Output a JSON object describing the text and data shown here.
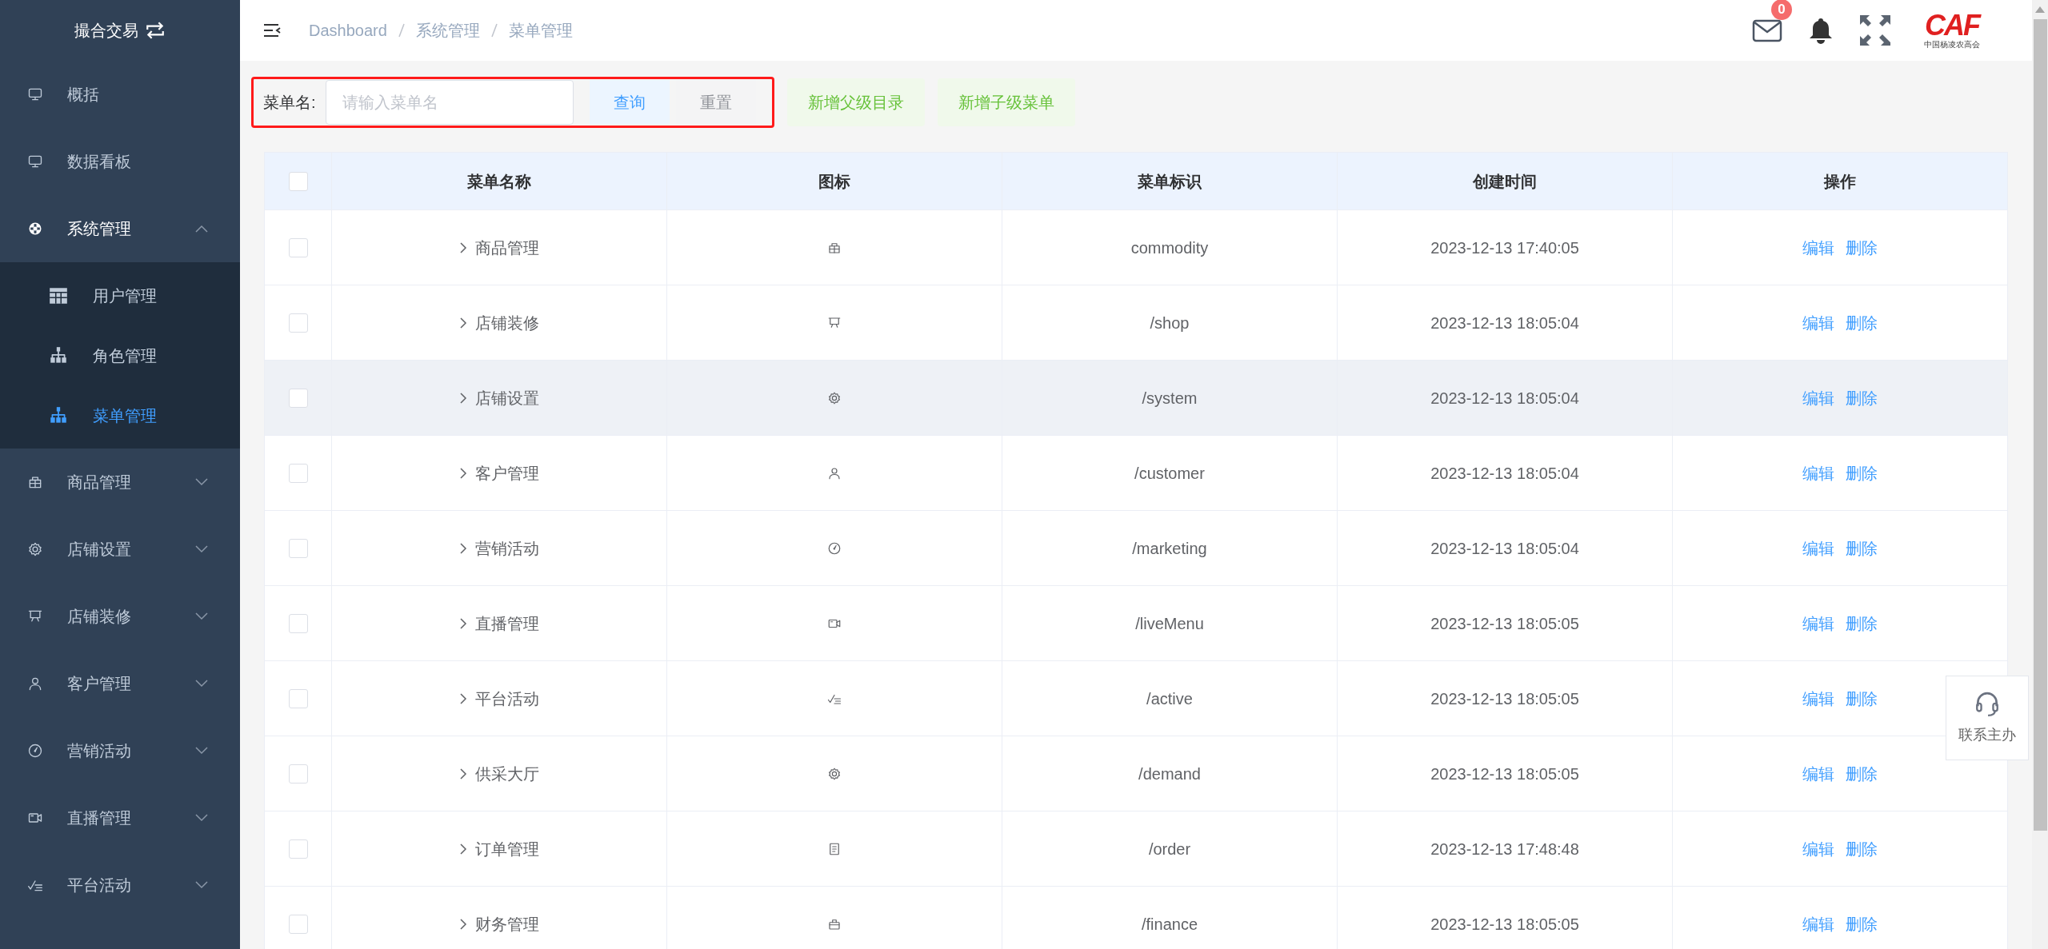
{
  "sidebar": {
    "title": "撮合交易",
    "items": [
      {
        "kind": "link",
        "label": "概括",
        "selected": false
      },
      {
        "kind": "link",
        "label": "数据看板",
        "selected": false
      },
      {
        "kind": "group",
        "label": "系统管理",
        "expanded": true,
        "children": [
          {
            "label": "用户管理",
            "selected": false
          },
          {
            "label": "角色管理",
            "selected": false
          },
          {
            "label": "菜单管理",
            "selected": true
          }
        ]
      },
      {
        "kind": "group",
        "label": "商品管理",
        "expanded": false
      },
      {
        "kind": "group",
        "label": "店铺设置",
        "expanded": false
      },
      {
        "kind": "group",
        "label": "店铺装修",
        "expanded": false
      },
      {
        "kind": "group",
        "label": "客户管理",
        "expanded": false
      },
      {
        "kind": "group",
        "label": "营销活动",
        "expanded": false
      },
      {
        "kind": "group",
        "label": "直播管理",
        "expanded": false
      },
      {
        "kind": "group",
        "label": "平台活动",
        "expanded": false
      }
    ]
  },
  "header": {
    "breadcrumb": [
      "Dashboard",
      "系统管理",
      "菜单管理"
    ],
    "mail_badge": "0",
    "logo": {
      "mark": "CAF",
      "caption": "中国杨凌农高会"
    }
  },
  "toolbar": {
    "label": "菜单名:",
    "placeholder": "请输入菜单名",
    "buttons": [
      {
        "kind": "primary",
        "label": "查询"
      },
      {
        "kind": "plain",
        "label": "重置"
      }
    ],
    "add_buttons": [
      "新增父级目录",
      "新增子级菜单"
    ]
  },
  "table": {
    "select_all": {
      "checked": false
    },
    "columns": [
      "菜单名称",
      "图标",
      "菜单标识",
      "创建时间",
      "操作"
    ],
    "rows": [
      {
        "checked": false,
        "hovered": false,
        "name": "商品管理",
        "key": "commodity",
        "created": "2023-12-13 17:40:05",
        "actions": [
          "编辑",
          "删除"
        ]
      },
      {
        "checked": false,
        "hovered": false,
        "name": "店铺装修",
        "key": "/shop",
        "created": "2023-12-13 18:05:04",
        "actions": [
          "编辑",
          "删除"
        ]
      },
      {
        "checked": false,
        "hovered": true,
        "name": "店铺设置",
        "key": "/system",
        "created": "2023-12-13 18:05:04",
        "actions": [
          "编辑",
          "删除"
        ]
      },
      {
        "checked": false,
        "hovered": false,
        "name": "客户管理",
        "key": "/customer",
        "created": "2023-12-13 18:05:04",
        "actions": [
          "编辑",
          "删除"
        ]
      },
      {
        "checked": false,
        "hovered": false,
        "name": "营销活动",
        "key": "/marketing",
        "created": "2023-12-13 18:05:04",
        "actions": [
          "编辑",
          "删除"
        ]
      },
      {
        "checked": false,
        "hovered": false,
        "name": "直播管理",
        "key": "/liveMenu",
        "created": "2023-12-13 18:05:05",
        "actions": [
          "编辑",
          "删除"
        ]
      },
      {
        "checked": false,
        "hovered": false,
        "name": "平台活动",
        "key": "/active",
        "created": "2023-12-13 18:05:05",
        "actions": [
          "编辑",
          "删除"
        ]
      },
      {
        "checked": false,
        "hovered": false,
        "name": "供采大厅",
        "key": "/demand",
        "created": "2023-12-13 18:05:05",
        "actions": [
          "编辑",
          "删除"
        ]
      },
      {
        "checked": false,
        "hovered": false,
        "name": "订单管理",
        "key": "/order",
        "created": "2023-12-13 17:48:48",
        "actions": [
          "编辑",
          "删除"
        ]
      },
      {
        "checked": false,
        "hovered": false,
        "name": "财务管理",
        "key": "/finance",
        "created": "2023-12-13 18:05:05",
        "actions": [
          "编辑",
          "删除"
        ]
      }
    ]
  },
  "contact": {
    "label": "联系主办"
  }
}
